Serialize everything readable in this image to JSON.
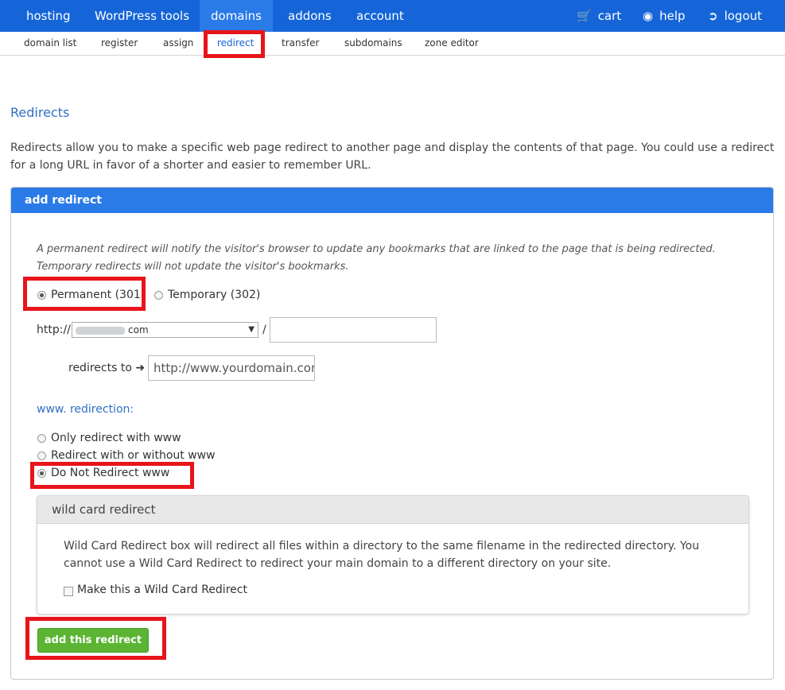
{
  "topnav": {
    "items": [
      {
        "label": "hosting"
      },
      {
        "label": "WordPress tools"
      },
      {
        "label": "domains"
      },
      {
        "label": "addons"
      },
      {
        "label": "account"
      }
    ],
    "cart": "cart",
    "help": "help",
    "logout": "logout"
  },
  "subnav": {
    "items": [
      {
        "label": "domain list"
      },
      {
        "label": "register"
      },
      {
        "label": "assign"
      },
      {
        "label": "redirect"
      },
      {
        "label": "transfer"
      },
      {
        "label": "subdomains"
      },
      {
        "label": "zone editor"
      }
    ]
  },
  "page": {
    "title": "Redirects",
    "intro": "Redirects allow you to make a specific web page redirect to another page and display the contents of that page. You could use a redirect for a long URL in favor of a shorter and easier to remember URL."
  },
  "panel": {
    "title": "add redirect",
    "note": "A permanent redirect will notify the visitor's browser to update any bookmarks that are linked to the page that is being redirected. Temporary redirects will not update the visitor's bookmarks.",
    "permanent_label": "Permanent (301)",
    "temporary_label": "Temporary (302)",
    "http_prefix": "http://",
    "domain_suffix": "com",
    "slash": "/",
    "path_value": "",
    "redirects_to_label": "redirects to",
    "redirect_target_value": "http://www.yourdomain.com",
    "www_section_label": "www. redirection:",
    "www_options": [
      {
        "label": "Only redirect with www"
      },
      {
        "label": "Redirect with or without www"
      },
      {
        "label": "Do Not Redirect www"
      }
    ],
    "wildcard": {
      "title": "wild card redirect",
      "description": "Wild Card Redirect box will redirect all files within a directory to the same filename in the redirected directory. You cannot use a Wild Card Redirect to redirect your main domain to a different directory on your site.",
      "checkbox_label": "Make this a Wild Card Redirect"
    },
    "submit_label": "add this redirect"
  },
  "colors": {
    "nav_blue": "#1565d8",
    "highlight_red": "#e8141b",
    "button_green": "#5bb533"
  }
}
